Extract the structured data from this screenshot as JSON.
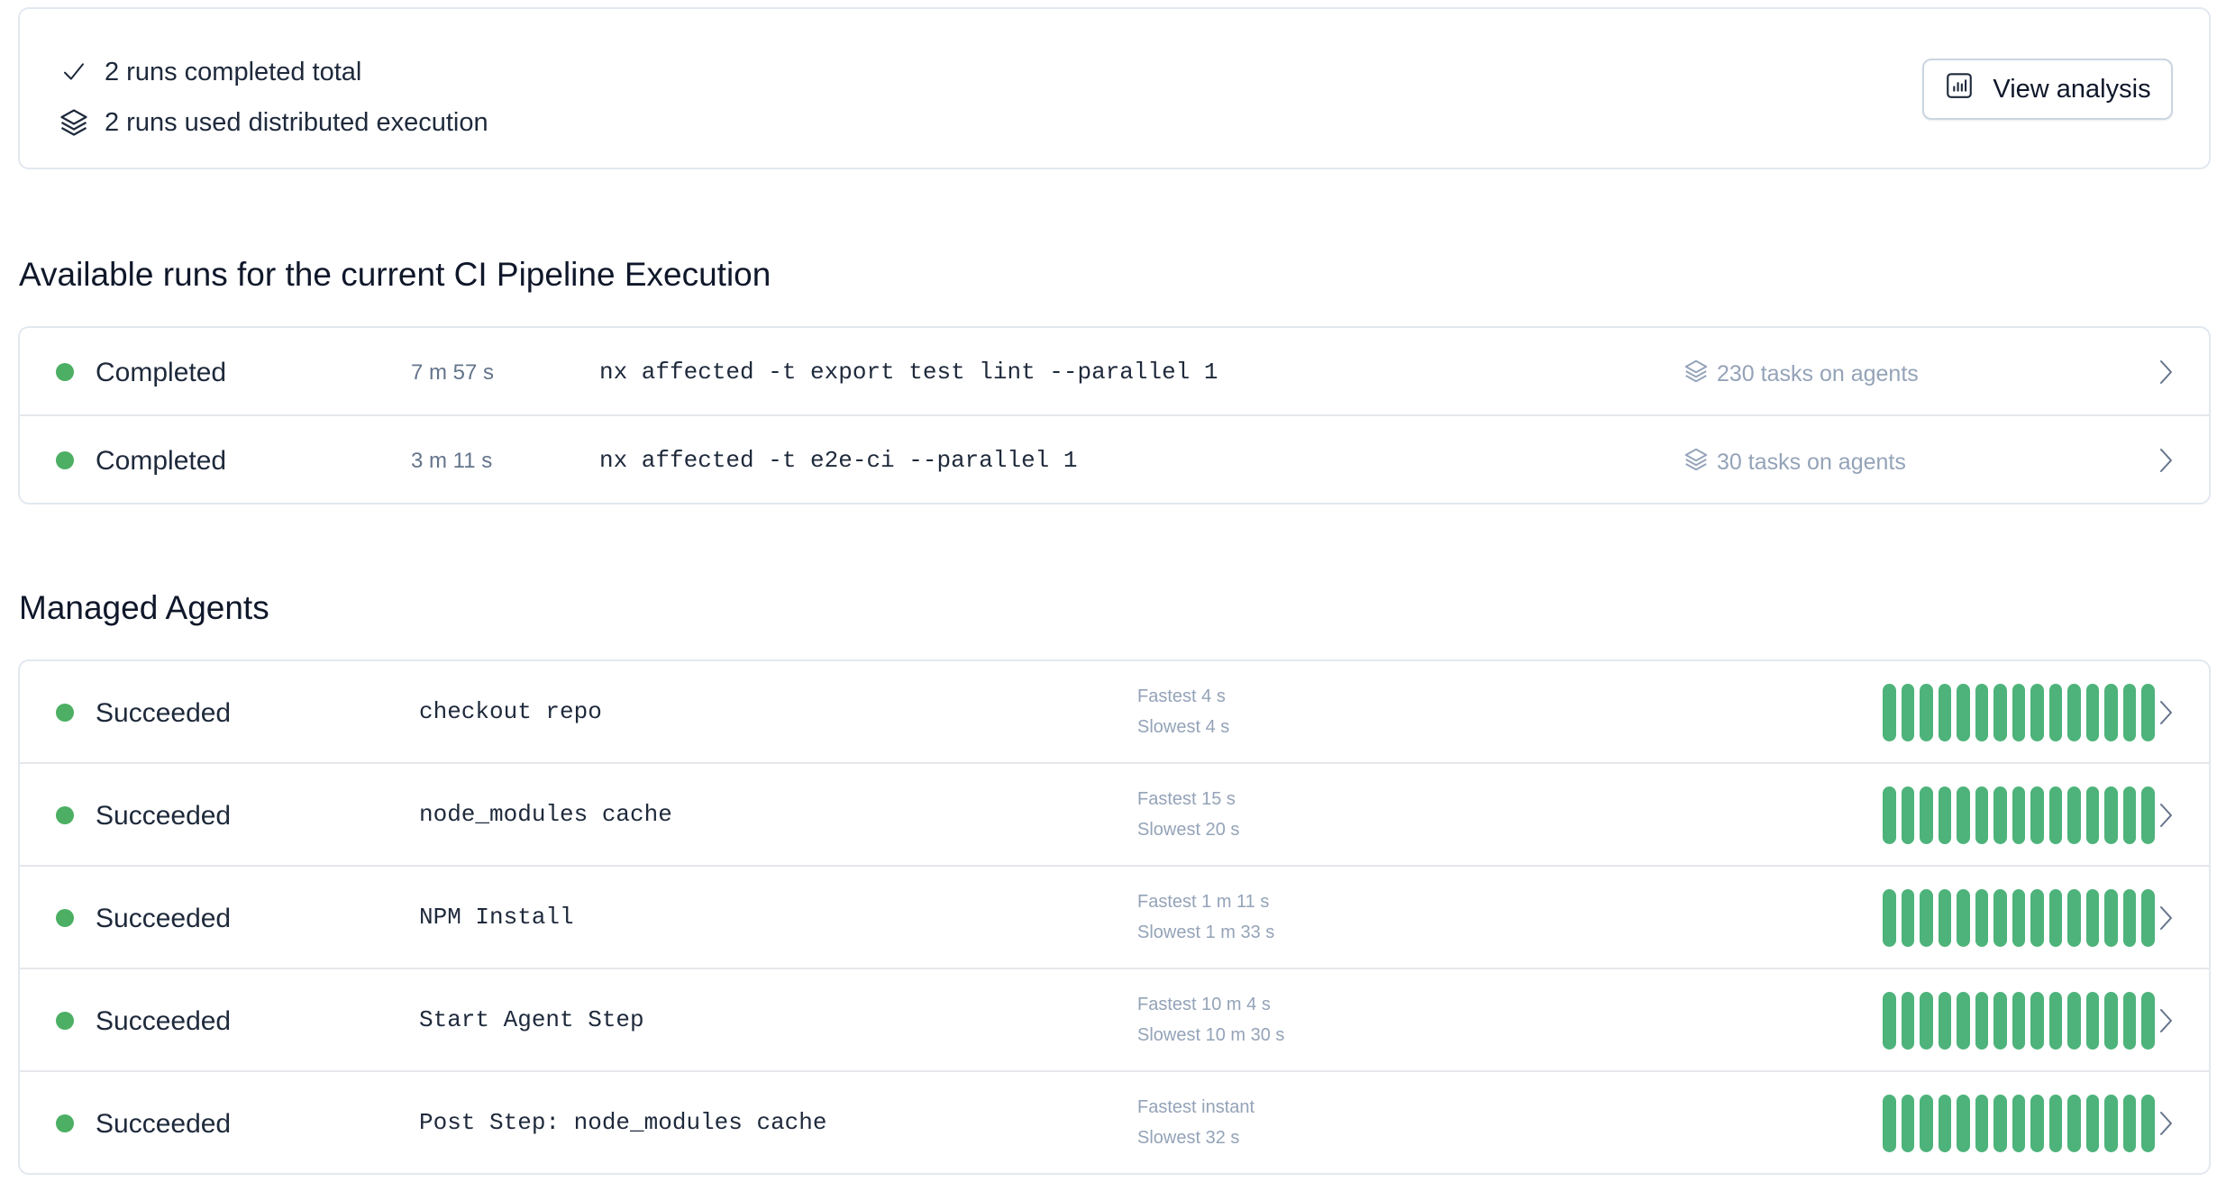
{
  "summary": {
    "runs_completed": "2 runs completed total",
    "runs_distributed": "2 runs used distributed execution",
    "view_analysis_label": "View analysis"
  },
  "runs_section": {
    "title": "Available runs for the current CI Pipeline Execution",
    "runs": [
      {
        "status": "Completed",
        "duration": "7 m 57 s",
        "command": "nx affected -t export test lint --parallel 1",
        "tasks": "230 tasks on agents"
      },
      {
        "status": "Completed",
        "duration": "3 m 11 s",
        "command": "nx affected -t e2e-ci --parallel 1",
        "tasks": "30 tasks on agents"
      }
    ]
  },
  "agents_section": {
    "title": "Managed Agents",
    "agents": [
      {
        "status": "Succeeded",
        "step": "checkout repo",
        "fastest": "Fastest 4 s",
        "slowest": "Slowest 4 s",
        "agent_count": 15
      },
      {
        "status": "Succeeded",
        "step": "node_modules cache",
        "fastest": "Fastest 15 s",
        "slowest": "Slowest 20 s",
        "agent_count": 15
      },
      {
        "status": "Succeeded",
        "step": "NPM Install",
        "fastest": "Fastest 1 m 11 s",
        "slowest": "Slowest 1 m 33 s",
        "agent_count": 15
      },
      {
        "status": "Succeeded",
        "step": "Start Agent Step",
        "fastest": "Fastest 10 m 4 s",
        "slowest": "Slowest 10 m 30 s",
        "agent_count": 15
      },
      {
        "status": "Succeeded",
        "step": "Post Step: node_modules cache",
        "fastest": "Fastest instant",
        "slowest": "Slowest 32 s",
        "agent_count": 15
      }
    ]
  },
  "colors": {
    "success_dot": "#4caf63",
    "agent_bar": "#4db37a",
    "border": "#e2e8f0",
    "muted_text": "#94a3b8"
  },
  "icons": {
    "completed": "check-icon",
    "distributed": "stack-layers-icon",
    "analysis": "bar-chart-icon",
    "row_action": "chevron-right-icon"
  }
}
